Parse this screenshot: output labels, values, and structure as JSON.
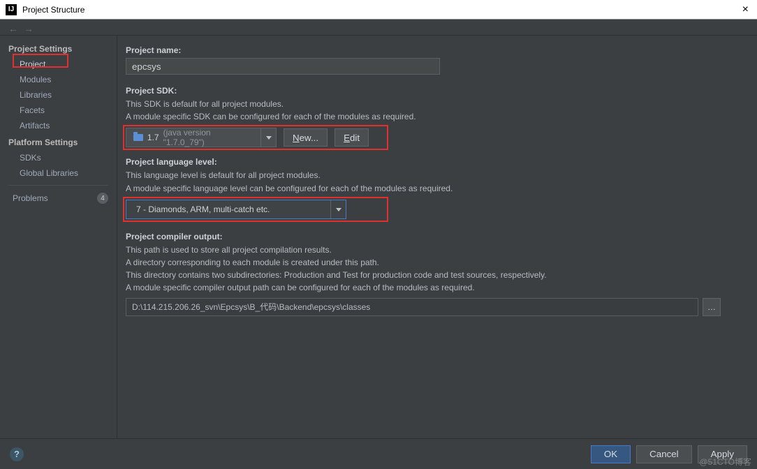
{
  "window": {
    "title": "Project Structure",
    "close": "×"
  },
  "sidebar": {
    "groups": [
      {
        "label": "Project Settings",
        "items": [
          {
            "label": "Project",
            "selected": true
          },
          {
            "label": "Modules"
          },
          {
            "label": "Libraries"
          },
          {
            "label": "Facets"
          },
          {
            "label": "Artifacts"
          }
        ]
      },
      {
        "label": "Platform Settings",
        "items": [
          {
            "label": "SDKs"
          },
          {
            "label": "Global Libraries"
          }
        ]
      }
    ],
    "problems": {
      "label": "Problems",
      "count": "4"
    }
  },
  "project": {
    "name_label": "Project name:",
    "name_value": "epcsys",
    "sdk_label": "Project SDK:",
    "sdk_desc1": "This SDK is default for all project modules.",
    "sdk_desc2": "A module specific SDK can be configured for each of the modules as required.",
    "sdk_name": "1.7",
    "sdk_version": "(java version \"1.7.0_79\")",
    "new_btn": "New...",
    "new_btn_u": "N",
    "edit_btn": "Edit",
    "edit_btn_u": "E",
    "lang_label": "Project language level:",
    "lang_desc1": "This language level is default for all project modules.",
    "lang_desc2": "A module specific language level can be configured for each of the modules as required.",
    "lang_value": "7 - Diamonds, ARM, multi-catch etc.",
    "out_label": "Project compiler output:",
    "out_desc1": "This path is used to store all project compilation results.",
    "out_desc2": "A directory corresponding to each module is created under this path.",
    "out_desc3": "This directory contains two subdirectories: Production and Test for production code and test sources, respectively.",
    "out_desc4": "A module specific compiler output path can be configured for each of the modules as required.",
    "out_value": "D:\\114.215.206.26_svn\\Epcsys\\B_代码\\Backend\\epcsys\\classes"
  },
  "footer": {
    "ok": "OK",
    "cancel": "Cancel",
    "apply": "Apply"
  },
  "watermark": "@51CTO博客"
}
